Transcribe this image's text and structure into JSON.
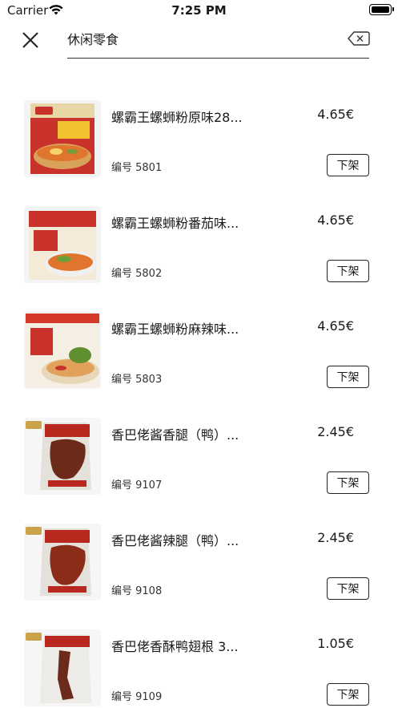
{
  "status_bar": {
    "carrier": "Carrier",
    "time": "7:25 PM"
  },
  "search": {
    "value": "休闲零食"
  },
  "icons": {
    "close": "close-icon",
    "clear": "clear-text-icon",
    "wifi": "wifi-icon",
    "battery": "battery-icon"
  },
  "products": [
    {
      "name": "螺霸王螺蛳粉原味28...",
      "price": "4.65€",
      "code": "编号 5801",
      "action": "下架",
      "thumb": "snail-noodle-original"
    },
    {
      "name": "螺霸王螺蛳粉番茄味...",
      "price": "4.65€",
      "code": "编号 5802",
      "action": "下架",
      "thumb": "snail-noodle-tomato"
    },
    {
      "name": "螺霸王螺蛳粉麻辣味...",
      "price": "4.65€",
      "code": "编号 5803",
      "action": "下架",
      "thumb": "snail-noodle-spicy"
    },
    {
      "name": "香巴佬酱香腿（鸭）...",
      "price": "2.45€",
      "code": "编号 9107",
      "action": "下架",
      "thumb": "duck-leg-sauce"
    },
    {
      "name": "香巴佬酱辣腿（鸭）...",
      "price": "2.45€",
      "code": "编号 9108",
      "action": "下架",
      "thumb": "duck-leg-spicy"
    },
    {
      "name": "香巴佬香酥鸭翅根 3...",
      "price": "1.05€",
      "code": "编号 9109",
      "action": "下架",
      "thumb": "duck-wing-root"
    }
  ],
  "colors": {
    "noodle_pack_red": "#c8322b",
    "noodle_pack_yellow": "#f2c230",
    "duck_pack_red": "#b8281f",
    "duck_meat": "#6b2a1a"
  }
}
